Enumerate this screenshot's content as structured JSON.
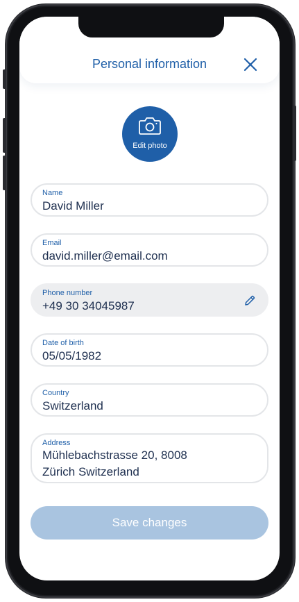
{
  "header": {
    "title": "Personal information",
    "close_icon": "close-icon"
  },
  "avatar": {
    "label": "Edit photo",
    "icon": "camera-icon"
  },
  "fields": {
    "name": {
      "label": "Name",
      "value": "David Miller"
    },
    "email": {
      "label": "Email",
      "value": "david.miller@email.com"
    },
    "phone": {
      "label": "Phone number",
      "value": "+49 30 34045987",
      "icon": "pencil-icon",
      "readonly": true
    },
    "dob": {
      "label": "Date of birth",
      "value": "05/05/1982"
    },
    "country": {
      "label": "Country",
      "value": "Switzerland"
    },
    "address": {
      "label": "Address",
      "value": "Mühlebachstrasse 20, 8008 Zürich  Switzerland"
    }
  },
  "save_button": {
    "label": "Save changes",
    "state": "disabled"
  },
  "colors": {
    "accent": "#1f5fa8",
    "text": "#1e2f4f",
    "border": "#e3e5e8",
    "readonly_bg": "#edeef0",
    "save_disabled": "#a9c4e0"
  }
}
